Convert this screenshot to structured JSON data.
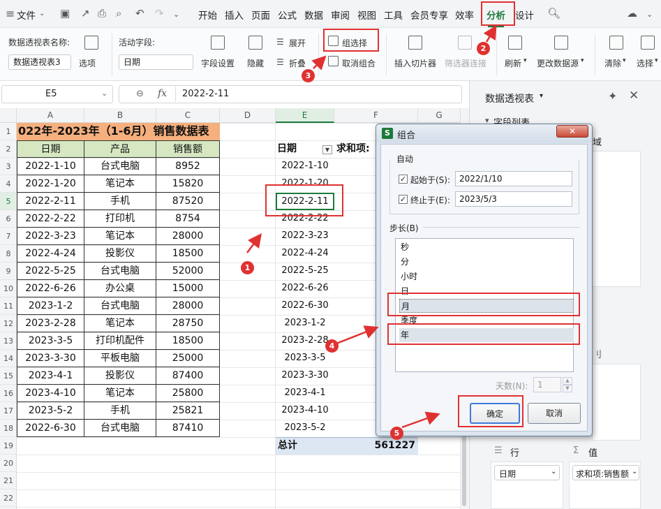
{
  "menubar": {
    "file_label": "文件",
    "tabs": [
      "开始",
      "插入",
      "页面",
      "公式",
      "数据",
      "审阅",
      "视图",
      "工具",
      "会员专享",
      "效率",
      "分析",
      "设计"
    ]
  },
  "ribbon": {
    "pivot_name_label": "数据透视表名称:",
    "pivot_name_value": "数据透视表3",
    "options_label": "选项",
    "active_field_label": "活动字段:",
    "active_field_value": "日期",
    "field_settings": "字段设置",
    "hide": "隐藏",
    "expand": "展开",
    "collapse": "折叠",
    "group_selection": "组选择",
    "ungroup": "取消组合",
    "insert_slicer": "插入切片器",
    "filter_connection": "筛选器连接",
    "refresh": "刷新",
    "change_source": "更改数据源",
    "clear": "清除",
    "select": "选择"
  },
  "formula_bar": {
    "cell_ref": "E5",
    "fx": "fx",
    "value": "2022-2-11"
  },
  "columns": [
    "A",
    "B",
    "C",
    "D",
    "E",
    "F",
    "G"
  ],
  "rows": [
    "1",
    "2",
    "3",
    "4",
    "5",
    "6",
    "7",
    "8",
    "9",
    "10",
    "11",
    "12",
    "13",
    "14",
    "15",
    "16",
    "17",
    "18",
    "19",
    "20",
    "21",
    "22"
  ],
  "table": {
    "title": "022年-2023年（1-6月）销售数据表",
    "headers": [
      "日期",
      "产品",
      "销售额"
    ],
    "rows": [
      [
        "2022-1-10",
        "台式电脑",
        "8952"
      ],
      [
        "2022-1-20",
        "笔记本",
        "15820"
      ],
      [
        "2022-2-11",
        "手机",
        "87520"
      ],
      [
        "2022-2-22",
        "打印机",
        "8754"
      ],
      [
        "2022-3-23",
        "笔记本",
        "28000"
      ],
      [
        "2022-4-24",
        "投影仪",
        "18500"
      ],
      [
        "2022-5-25",
        "台式电脑",
        "52000"
      ],
      [
        "2022-6-26",
        "办公桌",
        "15000"
      ],
      [
        "2023-1-2",
        "台式电脑",
        "28000"
      ],
      [
        "2023-2-28",
        "笔记本",
        "28750"
      ],
      [
        "2023-3-5",
        "打印机配件",
        "18500"
      ],
      [
        "2023-3-30",
        "平板电脑",
        "25000"
      ],
      [
        "2023-4-1",
        "投影仪",
        "87400"
      ],
      [
        "2023-4-10",
        "笔记本",
        "25800"
      ],
      [
        "2023-5-2",
        "手机",
        "25821"
      ],
      [
        "2022-6-30",
        "台式电脑",
        "87410"
      ]
    ]
  },
  "pivot": {
    "header_date": "日期",
    "header_sum": "求和项:",
    "dates": [
      "2022-1-10",
      "2022-1-20",
      "2022-2-11",
      "2022-2-22",
      "2022-3-23",
      "2022-4-24",
      "2022-5-25",
      "2022-6-26",
      "2022-6-30",
      "2023-1-2",
      "2023-2-28",
      "2023-3-5",
      "2023-3-30",
      "2023-4-1",
      "2023-4-10",
      "2023-5-2"
    ],
    "total_label": "总计",
    "total_value": "561227"
  },
  "right_pane": {
    "title": "数据透视表",
    "field_list": "字段列表",
    "trunc_text": "域",
    "rows_label": "行",
    "values_label": "值",
    "rows_field": "日期",
    "values_field": "求和项:销售额"
  },
  "dialog": {
    "title": "组合",
    "auto_label": "自动",
    "start_label": "起始于(S):",
    "start_value": "2022/1/10",
    "end_label": "终止于(E):",
    "end_value": "2023/5/3",
    "step_label": "步长(B)",
    "step_items": [
      "秒",
      "分",
      "小时",
      "日",
      "月",
      "季度",
      "年"
    ],
    "days_label": "天数(N):",
    "days_value": "1",
    "ok": "确定",
    "cancel": "取消"
  },
  "annotations": [
    "1",
    "2",
    "3",
    "4",
    "5"
  ],
  "colors": {
    "accent": "#1b7a3b",
    "annotation": "#e03131",
    "table_title_bg": "#f5b07e",
    "table_header_bg": "#d6e7c2"
  }
}
